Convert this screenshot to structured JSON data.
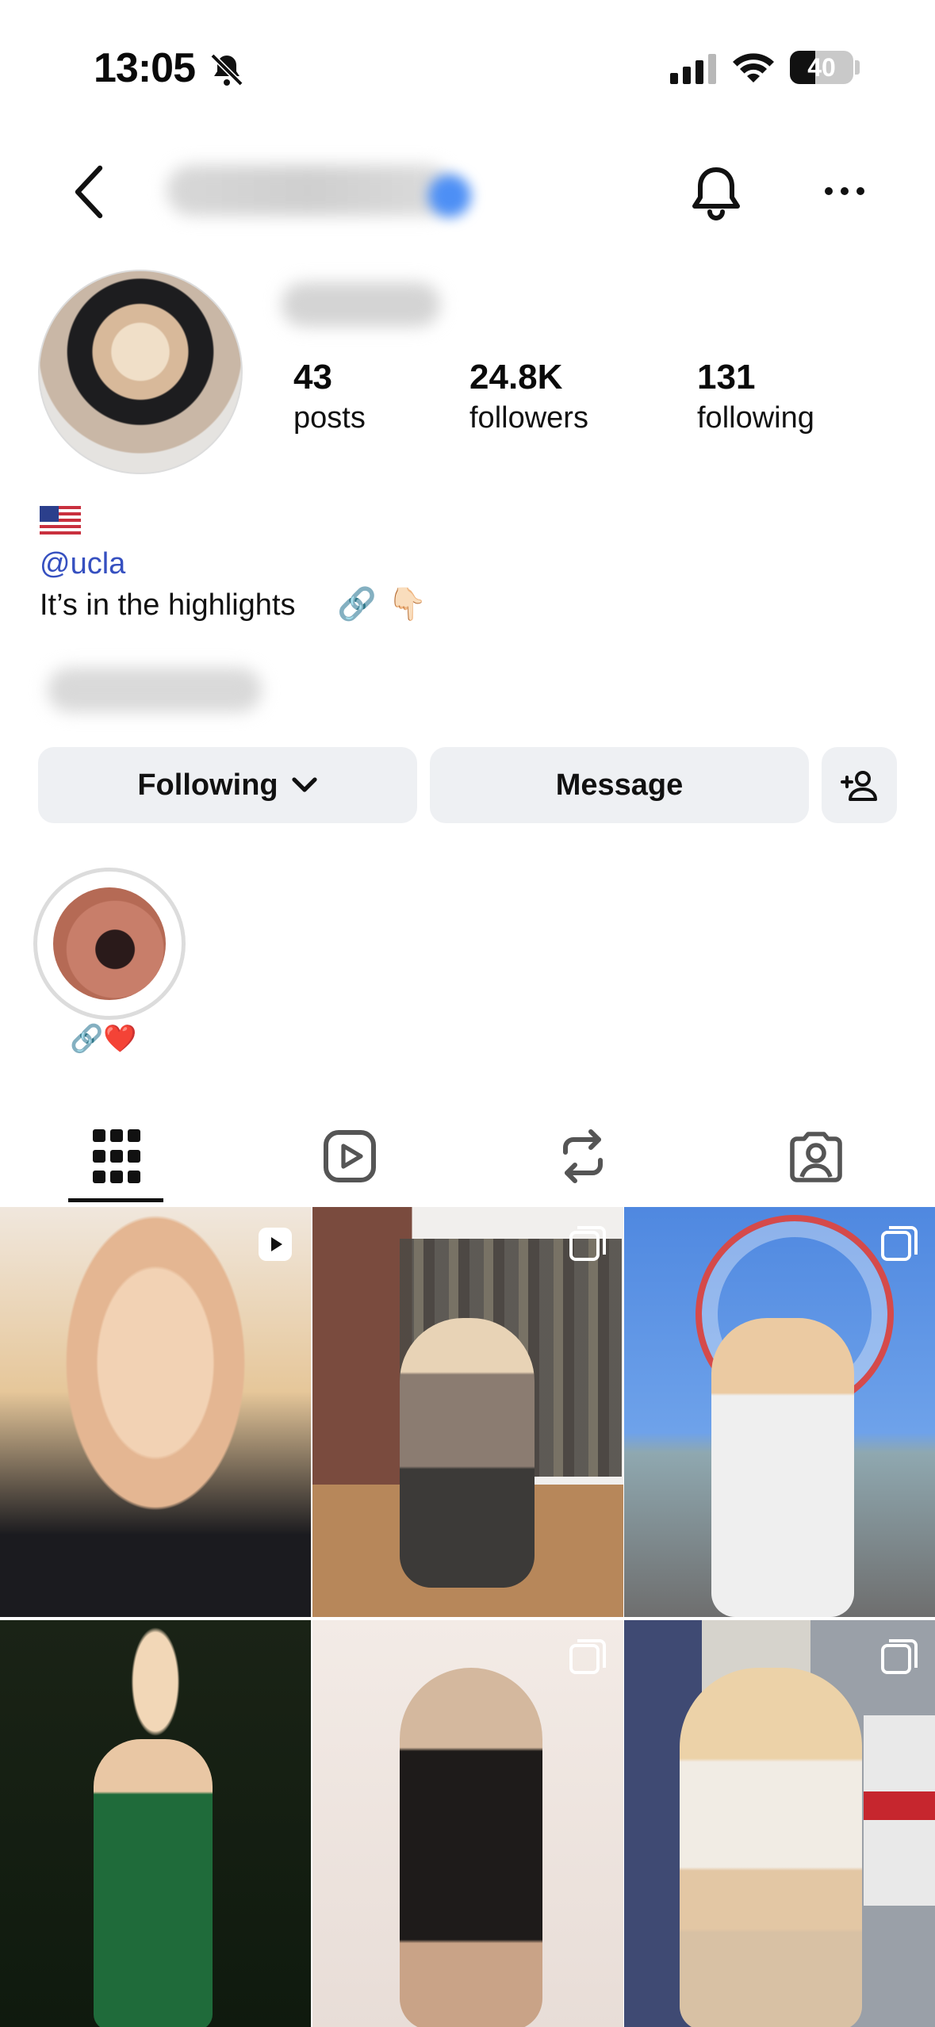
{
  "status_bar": {
    "time": "13:05",
    "battery": "40",
    "battery_level_percent": 40,
    "signal_bars_active": 3,
    "signal_bars_total": 4
  },
  "header": {
    "back_icon": "chevron-left-icon",
    "notification_icon": "bell-icon",
    "more_icon": "ellipsis-icon"
  },
  "profile": {
    "stats": [
      {
        "value": "43",
        "label": "posts"
      },
      {
        "value": "24.8K",
        "label": "followers"
      },
      {
        "value": "131",
        "label": "following"
      }
    ],
    "flag": "🇺🇸",
    "handle_link": "@ucla",
    "bio": "It’s in the highlights",
    "bio_emojis": [
      "🔗",
      "👇🏻"
    ]
  },
  "actions": {
    "following_label": "Following",
    "message_label": "Message"
  },
  "highlights": [
    {
      "label": "🔗❤️"
    }
  ],
  "tabs": [
    "posts-grid-icon",
    "reels-icon",
    "reposts-icon",
    "tagged-icon"
  ],
  "posts": [
    {
      "type": "reel"
    },
    {
      "type": "carousel"
    },
    {
      "type": "carousel"
    },
    {
      "type": "photo"
    },
    {
      "type": "carousel"
    },
    {
      "type": "carousel"
    }
  ],
  "colors": {
    "link": "#3650c0",
    "button_bg": "#eef0f3",
    "text": "#0a0a0a"
  }
}
